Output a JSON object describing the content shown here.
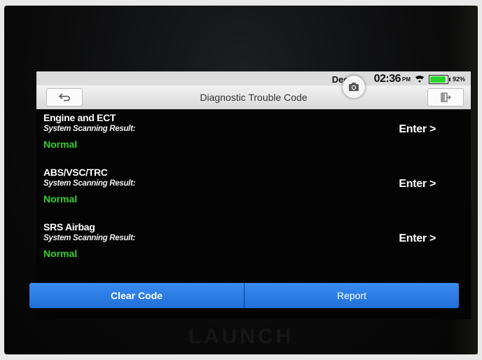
{
  "status_bar": {
    "date": "Dec",
    "time": "02:36",
    "ampm": "PM",
    "battery_pct": "92%",
    "battery_level": 0.92,
    "icons": [
      "wifi-icon",
      "battery-icon",
      "camera-icon"
    ]
  },
  "header": {
    "title": "Diagnostic Trouble Code",
    "back_icon": "back-arrow-icon",
    "exit_icon": "exit-icon"
  },
  "systems": [
    {
      "name": "Engine and ECT",
      "result_label": "System Scanning Result:",
      "status": "Normal",
      "action": "Enter >"
    },
    {
      "name": "ABS/VSC/TRC",
      "result_label": "System Scanning Result:",
      "status": "Normal",
      "action": "Enter >"
    },
    {
      "name": "SRS Airbag",
      "result_label": "System Scanning Result:",
      "status": "Normal",
      "action": "Enter >"
    }
  ],
  "actions": {
    "clear_code": "Clear Code",
    "report": "Report"
  },
  "brand": "LAUNCH",
  "colors": {
    "normal_status": "#34d02b",
    "action_button": "#2a7ee6",
    "header_bg": "#e6e6e6",
    "screen_bg": "#040405"
  }
}
